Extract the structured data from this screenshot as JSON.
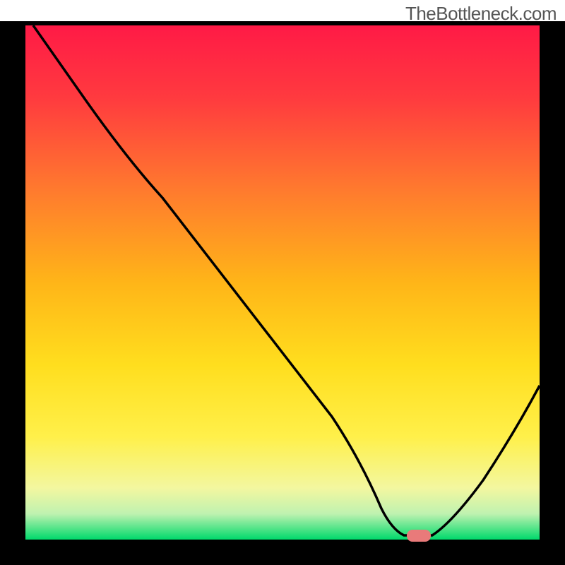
{
  "watermark": "TheBottleneck.com",
  "chart_data": {
    "type": "line",
    "title": "",
    "xlabel": "",
    "ylabel": "",
    "xlim": [
      0,
      100
    ],
    "ylim": [
      0,
      100
    ],
    "x": [
      4,
      12,
      20,
      25,
      30,
      40,
      50,
      58,
      62,
      66,
      70,
      74,
      78,
      82,
      88,
      94,
      100
    ],
    "values": [
      100,
      87,
      75,
      68,
      63,
      50,
      37,
      24,
      14,
      5,
      1,
      0.5,
      0.5,
      2,
      10,
      20,
      30
    ],
    "curve_note": "V-shaped bottleneck curve; minimum around x≈75 then rises again",
    "marker": {
      "x": 75,
      "y": 1.2,
      "shape": "rounded-rect",
      "color": "#e97a7a"
    },
    "background_gradient_top": "#ff1a46",
    "background_gradient_mid": "#ffd400",
    "background_gradient_bottom": "#00d96b",
    "frame_color": "#000000",
    "frame_thickness_px": 36
  }
}
